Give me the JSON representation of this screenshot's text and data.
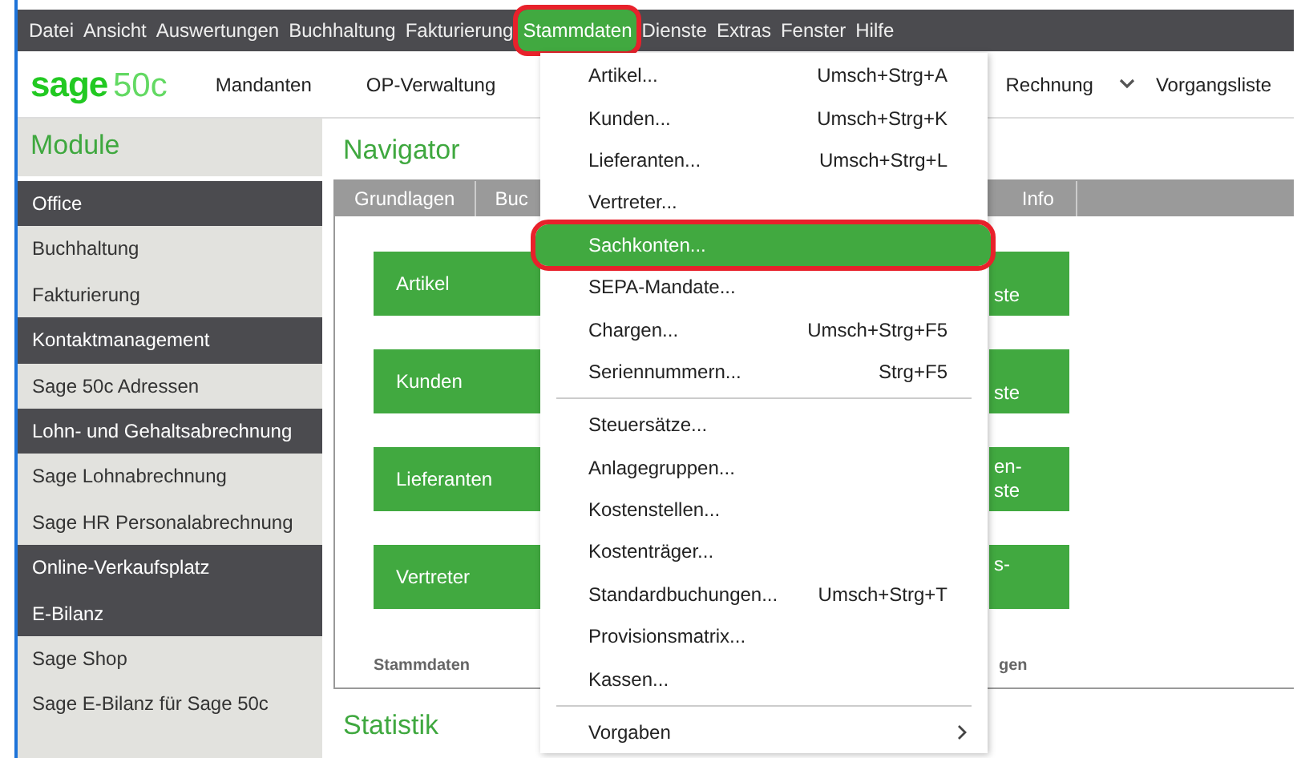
{
  "menubar": [
    {
      "label": "Datei",
      "selected": false,
      "annotated": false
    },
    {
      "label": "Ansicht",
      "selected": false,
      "annotated": false
    },
    {
      "label": "Auswertungen",
      "selected": false,
      "annotated": false
    },
    {
      "label": "Buchhaltung",
      "selected": false,
      "annotated": false
    },
    {
      "label": "Fakturierung",
      "selected": false,
      "annotated": false
    },
    {
      "label": "Stammdaten",
      "selected": true,
      "annotated": true
    },
    {
      "label": "Dienste",
      "selected": false,
      "annotated": false
    },
    {
      "label": "Extras",
      "selected": false,
      "annotated": false
    },
    {
      "label": "Fenster",
      "selected": false,
      "annotated": false
    },
    {
      "label": "Hilfe",
      "selected": false,
      "annotated": false
    }
  ],
  "toolbar": {
    "logo_word": "sage",
    "logo_suffix": "50c",
    "left_items": [
      "Mandanten",
      "OP-Verwaltung"
    ],
    "right_items": [
      {
        "label": "Rechnung",
        "kind": "text"
      },
      {
        "kind": "chevron"
      },
      {
        "label": "Vorgangsliste",
        "kind": "text"
      }
    ]
  },
  "sidebar": {
    "title": "Module",
    "items": [
      {
        "label": "Office",
        "kind": "header"
      },
      {
        "label": "Buchhaltung",
        "kind": "item"
      },
      {
        "label": "Fakturierung",
        "kind": "item"
      },
      {
        "label": "Kontaktmanagement",
        "kind": "header"
      },
      {
        "label": "Sage 50c Adressen",
        "kind": "item"
      },
      {
        "label": "Lohn- und Gehaltsabrechnung",
        "kind": "header"
      },
      {
        "label": "Sage Lohnabrechnung",
        "kind": "item"
      },
      {
        "label": "Sage HR Personalabrechnung",
        "kind": "item"
      },
      {
        "label": "Online-Verkaufsplatz",
        "kind": "header"
      },
      {
        "label": "E-Bilanz",
        "kind": "header"
      },
      {
        "label": "Sage Shop",
        "kind": "item"
      },
      {
        "label": "Sage E-Bilanz für Sage 50c",
        "kind": "item"
      }
    ]
  },
  "navigator": {
    "title": "Navigator",
    "tabs": [
      {
        "label": "Grundlagen",
        "selected": false
      },
      {
        "label": "Buc",
        "selected": false
      },
      {
        "label": "Info",
        "selected": false
      }
    ],
    "tiles_left": [
      "Artikel",
      "Kunden",
      "Lieferanten",
      "Vertreter"
    ],
    "tiles_right": [
      {
        "bottom": "ste"
      },
      {
        "bottom": "ste"
      },
      {
        "top": "en-",
        "bottom": "ste"
      },
      {
        "top": "s-"
      }
    ],
    "footers": [
      "Stammdaten",
      "gen"
    ]
  },
  "section_below": "Statistik",
  "dropdown": {
    "items": [
      {
        "label": "Artikel...",
        "shortcut": "Umsch+Strg+A",
        "kind": "item",
        "selected": false,
        "annotated": false
      },
      {
        "label": "Kunden...",
        "shortcut": "Umsch+Strg+K",
        "kind": "item",
        "selected": false,
        "annotated": false
      },
      {
        "label": "Lieferanten...",
        "shortcut": "Umsch+Strg+L",
        "kind": "item",
        "selected": false,
        "annotated": false
      },
      {
        "label": "Vertreter...",
        "kind": "item",
        "selected": false,
        "annotated": false
      },
      {
        "label": "Sachkonten...",
        "kind": "item",
        "selected": true,
        "annotated": true
      },
      {
        "label": "SEPA-Mandate...",
        "kind": "item",
        "selected": false,
        "annotated": false
      },
      {
        "label": "Chargen...",
        "shortcut": "Umsch+Strg+F5",
        "kind": "item",
        "selected": false,
        "annotated": false
      },
      {
        "label": "Seriennummern...",
        "shortcut": "Strg+F5",
        "kind": "item",
        "selected": false,
        "annotated": false
      },
      {
        "kind": "separator"
      },
      {
        "label": "Steuersätze...",
        "kind": "item",
        "selected": false,
        "annotated": false
      },
      {
        "label": "Anlagegruppen...",
        "kind": "item",
        "selected": false,
        "annotated": false
      },
      {
        "label": "Kostenstellen...",
        "kind": "item",
        "selected": false,
        "annotated": false
      },
      {
        "label": "Kostenträger...",
        "kind": "item",
        "selected": false,
        "annotated": false
      },
      {
        "label": "Standardbuchungen...",
        "shortcut": "Umsch+Strg+T",
        "kind": "item",
        "selected": false,
        "annotated": false
      },
      {
        "label": "Provisionsmatrix...",
        "kind": "item",
        "selected": false,
        "annotated": false
      },
      {
        "label": "Kassen...",
        "kind": "item",
        "selected": false,
        "annotated": false
      },
      {
        "kind": "separator"
      },
      {
        "label": "Vorgaben",
        "kind": "submenu",
        "selected": false,
        "annotated": false
      }
    ]
  }
}
